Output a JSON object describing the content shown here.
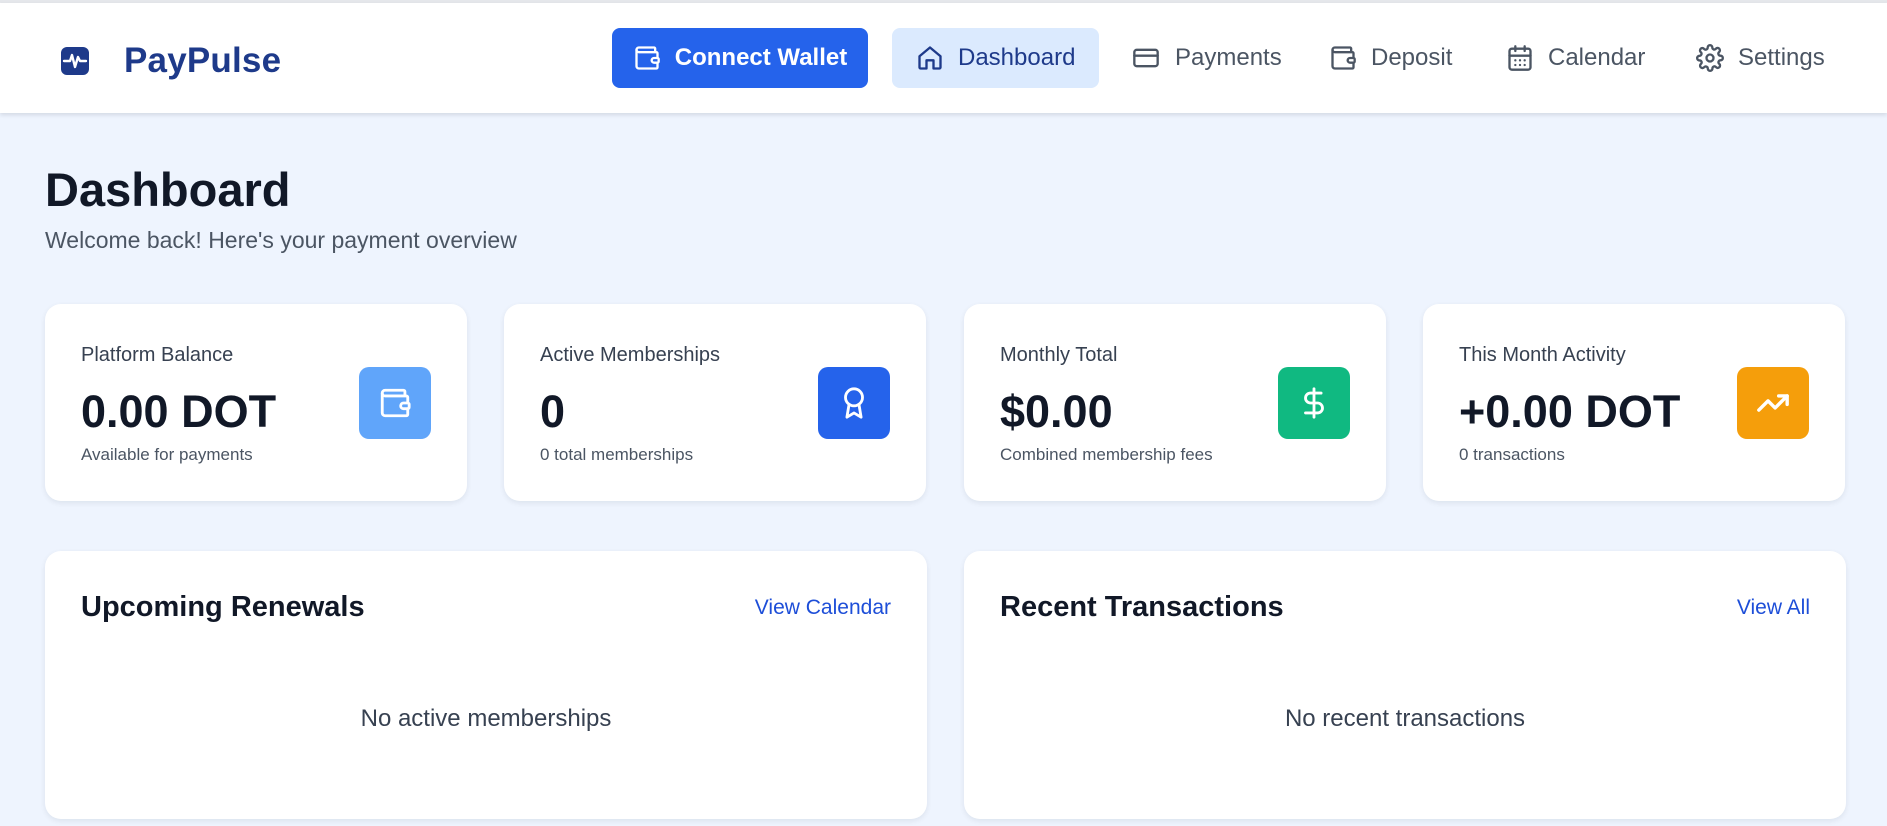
{
  "header": {
    "brand_name": "PayPulse",
    "brand_icon": "pulse-icon",
    "connect_wallet_label": "Connect Wallet",
    "nav": [
      {
        "label": "Dashboard",
        "icon": "home-icon",
        "active": true
      },
      {
        "label": "Payments",
        "icon": "credit-card-icon",
        "active": false
      },
      {
        "label": "Deposit",
        "icon": "wallet-icon",
        "active": false
      },
      {
        "label": "Calendar",
        "icon": "calendar-icon",
        "active": false
      },
      {
        "label": "Settings",
        "icon": "gear-icon",
        "active": false
      }
    ]
  },
  "page": {
    "title": "Dashboard",
    "subtitle": "Welcome back! Here's your payment overview"
  },
  "stats": [
    {
      "label": "Platform Balance",
      "value": "0.00 DOT",
      "sub": "Available for payments",
      "icon": "wallet-icon",
      "color": "#60a5fa"
    },
    {
      "label": "Active Memberships",
      "value": "0",
      "sub": "0 total memberships",
      "icon": "award-icon",
      "color": "#2563eb"
    },
    {
      "label": "Monthly Total",
      "value": "$0.00",
      "sub": "Combined membership fees",
      "icon": "dollar-icon",
      "color": "#10b981"
    },
    {
      "label": "This Month Activity",
      "value": "+0.00 DOT",
      "sub": "0 transactions",
      "icon": "trending-up-icon",
      "color": "#f59e0b"
    }
  ],
  "panels": {
    "renewals": {
      "title": "Upcoming Renewals",
      "link": "View Calendar",
      "empty": "No active memberships"
    },
    "transactions": {
      "title": "Recent Transactions",
      "link": "View All",
      "empty": "No recent transactions"
    }
  },
  "colors": {
    "primary": "#2563eb",
    "brand_text": "#1e3a8a",
    "active_nav_bg": "#dbeafe",
    "page_bg": "#eef4fe",
    "link": "#1d4ed8"
  }
}
